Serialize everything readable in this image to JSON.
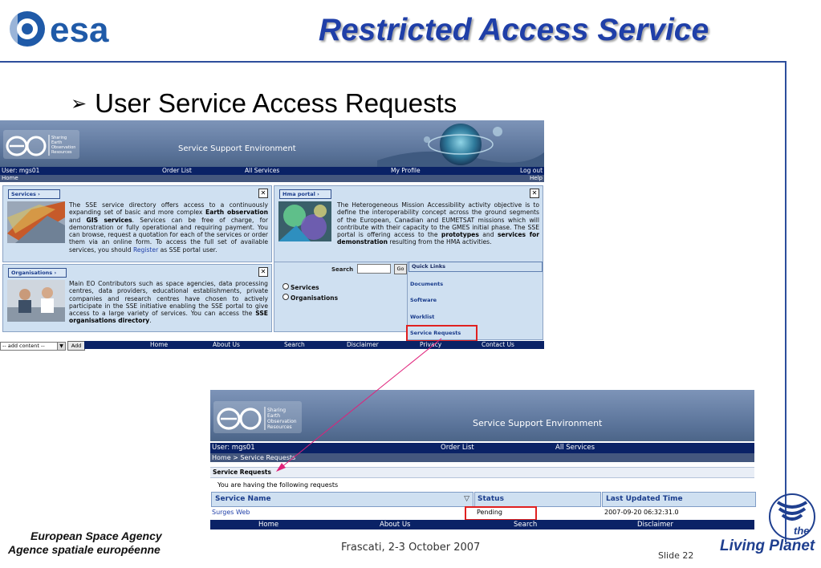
{
  "slide": {
    "logo_text": "esa",
    "title": "Restricted Access Service",
    "bullet": "User Service Access Requests",
    "agency_en": "European Space Agency",
    "agency_fr": "Agence spatiale européenne",
    "footer_place": "Frascati, 2-3 October 2007",
    "slide_number": "Slide 22",
    "living_planet_the": "the",
    "living_planet": "Living Planet",
    "brand_color": "#1f3fa8",
    "highlight_color": "#e02020"
  },
  "sse_home": {
    "logo_lines": [
      "Sharing",
      "Earth",
      "Observation",
      "Resources"
    ],
    "banner_title": "Service Support Environment",
    "nav": {
      "user": "User: mgs01",
      "order_list": "Order List",
      "all_services": "All Services",
      "my_profile": "My Profile",
      "log_out": "Log out"
    },
    "crumb": {
      "home": "Home",
      "help": "Help"
    },
    "services": {
      "header": "Services ›",
      "t1": "The SSE service directory offers access to a continuously expanding set of basic and more complex ",
      "b1": "Earth observation",
      "t2": " and ",
      "b2": "GIS services",
      "t3": ". Services can be free of charge, for demonstration or fully operational and requiring payment. You can browse, request a quotation for each of the services or order them via an online form. To access the full set of available services, you should ",
      "link": "Register",
      "t4": " as SSE portal user."
    },
    "hma": {
      "header": "Hma portal ›",
      "t1": "The Heterogeneous Mission Accessibility activity objective is to define the interoperability concept across the ground segments of the European, Canadian and EUMETSAT missions which will contribute with their capacity to the GMES initial phase. The SSE portal is offering access to the ",
      "b1": "prototypes",
      "t2": " and ",
      "b2": "services for demonstration",
      "t3": " resulting from the HMA activities."
    },
    "organisations": {
      "header": "Organisations ›",
      "t1": "Main EO Contributors such as space agencies, data processing centres, data providers, educational establishments, private companies and research centres have chosen to actively participate in the SSE initiative enabling the SSE portal to give access to a large variety of services. You can access the ",
      "b1": "SSE organisations directory",
      "t2": "."
    },
    "close_glyph": "✕",
    "search": {
      "label": "Search",
      "go": "Go",
      "radio_services": "Services",
      "radio_orgs": "Organisations"
    },
    "quick_links": {
      "header": "Quick Links",
      "items": [
        "Documents",
        "Software",
        "Worklist",
        "Service Requests"
      ]
    },
    "bottom": {
      "add_select": "-- add content --",
      "add_button": "Add",
      "links": [
        "Home",
        "About Us",
        "Search",
        "Disclaimer",
        "Privacy",
        "Contact Us"
      ]
    }
  },
  "sse_requests": {
    "logo_lines": [
      "Sharing",
      "Earth",
      "Observation",
      "Resources"
    ],
    "banner_title": "Service Support Environment",
    "nav": {
      "user": "User: mgs01",
      "order_list": "Order List",
      "all_services": "All Services"
    },
    "crumb": "Home > Service Requests",
    "section_title": "Service Requests",
    "subtitle": "You are having the following requests",
    "columns": [
      "Service Name",
      "Status",
      "Last Updated Time"
    ],
    "sort_glyph": "▽",
    "rows": [
      {
        "service": "Surges Web",
        "status": "Pending",
        "updated": "2007-09-20 06:32:31.0"
      }
    ],
    "footer_links": [
      "Home",
      "About Us",
      "Search",
      "Disclaimer"
    ]
  }
}
